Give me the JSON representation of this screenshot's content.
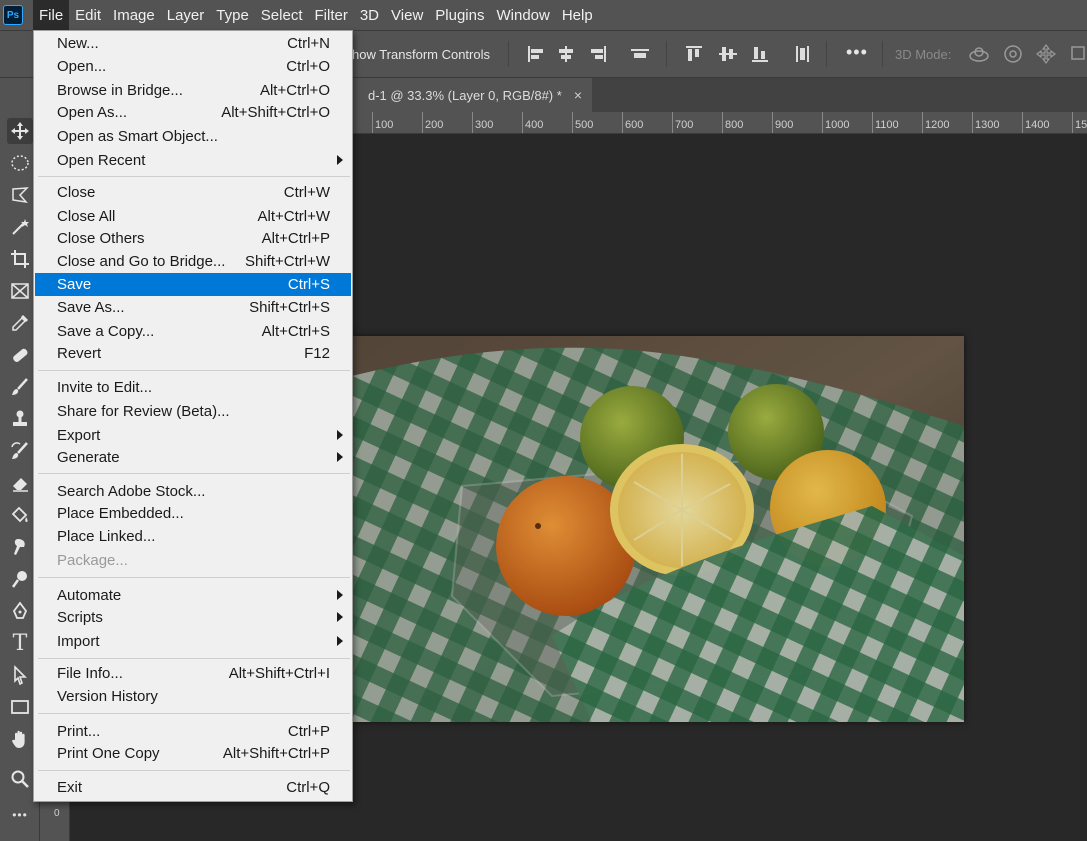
{
  "app": {
    "logo_text": "Ps"
  },
  "menubar": {
    "items": [
      "File",
      "Edit",
      "Image",
      "Layer",
      "Type",
      "Select",
      "Filter",
      "3D",
      "View",
      "Plugins",
      "Window",
      "Help"
    ],
    "active": "File"
  },
  "options_bar": {
    "transform_controls_label": "how Transform Controls",
    "three_d_mode_label": "3D Mode:",
    "more_icon": "more-horizontal-icon"
  },
  "document_tab": {
    "title": "d-1 @ 33.3% (Layer 0, RGB/8#) *",
    "close_glyph": "×"
  },
  "ruler_top": {
    "labels": [
      "100",
      "200",
      "300",
      "400",
      "500",
      "600",
      "700",
      "800",
      "900",
      "1000",
      "1100",
      "1200",
      "1300",
      "1400",
      "15"
    ]
  },
  "ruler_left": {
    "labels": [
      "0"
    ]
  },
  "toolbar": {
    "tools": [
      "move-tool",
      "elliptical-marquee-tool",
      "lasso-tool",
      "magic-wand-tool",
      "crop-tool",
      "frame-tool",
      "eyedropper-tool",
      "healing-brush-tool",
      "brush-tool",
      "clone-stamp-tool",
      "history-brush-tool",
      "eraser-tool",
      "paint-bucket-tool",
      "smudge-tool",
      "dodge-tool",
      "pen-tool",
      "type-tool",
      "path-selection-tool",
      "rectangle-tool",
      "hand-tool",
      "zoom-tool",
      "edit-toolbar"
    ],
    "type_glyph": "T",
    "more_glyph": "•••"
  },
  "file_menu": {
    "rows": [
      {
        "label": "New...",
        "shortcut": "Ctrl+N"
      },
      {
        "label": "Open...",
        "shortcut": "Ctrl+O"
      },
      {
        "label": "Browse in Bridge...",
        "shortcut": "Alt+Ctrl+O"
      },
      {
        "label": "Open As...",
        "shortcut": "Alt+Shift+Ctrl+O"
      },
      {
        "label": "Open as Smart Object...",
        "shortcut": ""
      },
      {
        "label": "Open Recent",
        "shortcut": ""
      },
      {
        "label": "Close",
        "shortcut": "Ctrl+W"
      },
      {
        "label": "Close All",
        "shortcut": "Alt+Ctrl+W"
      },
      {
        "label": "Close Others",
        "shortcut": "Alt+Ctrl+P"
      },
      {
        "label": "Close and Go to Bridge...",
        "shortcut": "Shift+Ctrl+W"
      },
      {
        "label": "Save",
        "shortcut": "Ctrl+S"
      },
      {
        "label": "Save As...",
        "shortcut": "Shift+Ctrl+S"
      },
      {
        "label": "Save a Copy...",
        "shortcut": "Alt+Ctrl+S"
      },
      {
        "label": "Revert",
        "shortcut": "F12"
      },
      {
        "label": "Invite to Edit...",
        "shortcut": ""
      },
      {
        "label": "Share for Review (Beta)...",
        "shortcut": ""
      },
      {
        "label": "Export",
        "shortcut": ""
      },
      {
        "label": "Generate",
        "shortcut": ""
      },
      {
        "label": "Search Adobe Stock...",
        "shortcut": ""
      },
      {
        "label": "Place Embedded...",
        "shortcut": ""
      },
      {
        "label": "Place Linked...",
        "shortcut": ""
      },
      {
        "label": "Package...",
        "shortcut": ""
      },
      {
        "label": "Automate",
        "shortcut": ""
      },
      {
        "label": "Scripts",
        "shortcut": ""
      },
      {
        "label": "Import",
        "shortcut": ""
      },
      {
        "label": "File Info...",
        "shortcut": "Alt+Shift+Ctrl+I"
      },
      {
        "label": "Version History",
        "shortcut": ""
      },
      {
        "label": "Print...",
        "shortcut": "Ctrl+P"
      },
      {
        "label": "Print One Copy",
        "shortcut": "Alt+Shift+Ctrl+P"
      },
      {
        "label": "Exit",
        "shortcut": "Ctrl+Q"
      }
    ],
    "highlighted": "Save",
    "disabled": [
      "Package..."
    ],
    "submenus": [
      "Open Recent",
      "Export",
      "Generate",
      "Automate",
      "Scripts",
      "Import"
    ]
  },
  "colors": {
    "menu_highlight": "#0078d7",
    "panel": "#535353",
    "canvas": "#282828"
  }
}
